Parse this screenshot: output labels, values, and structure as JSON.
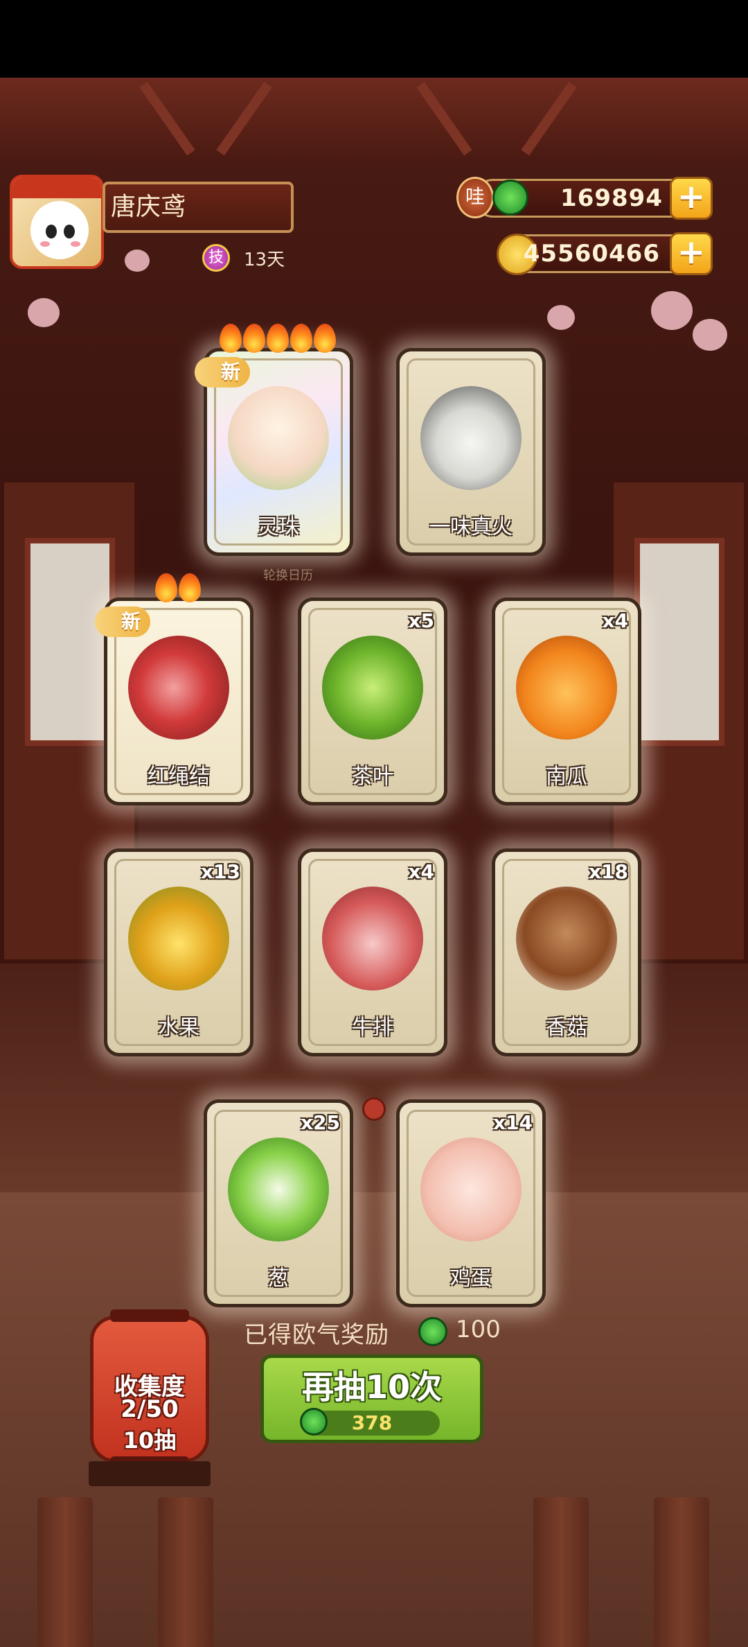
{
  "player": {
    "name": "唐庆鸢",
    "skill_icon": "技",
    "days": "13天"
  },
  "currencies": {
    "jade": {
      "icon": "jade-coin-icon",
      "badge": "哇",
      "value": "169894"
    },
    "gold": {
      "icon": "gold-coin-icon",
      "value": "45560466"
    },
    "plus_label": "+"
  },
  "scene_label": "轮换日历",
  "cards": [
    {
      "name": "灵珠",
      "count": "",
      "new": "新",
      "flames": 5,
      "style": "rainbow",
      "icon": "spirit-pearl-icon"
    },
    {
      "name": "一味真火",
      "count": "",
      "new": "",
      "flames": 0,
      "style": "plain",
      "icon": "true-fire-icon"
    },
    {
      "name": "红绳结",
      "count": "",
      "new": "新",
      "flames": 2,
      "style": "glowy",
      "icon": "red-knot-icon"
    },
    {
      "name": "茶叶",
      "count": "x5",
      "new": "",
      "flames": 0,
      "style": "plain",
      "icon": "tea-leaf-icon"
    },
    {
      "name": "南瓜",
      "count": "x4",
      "new": "",
      "flames": 0,
      "style": "plain",
      "icon": "pumpkin-icon"
    },
    {
      "name": "水果",
      "count": "x13",
      "new": "",
      "flames": 0,
      "style": "plain",
      "icon": "fruit-icon"
    },
    {
      "name": "牛排",
      "count": "x4",
      "new": "",
      "flames": 0,
      "style": "plain",
      "icon": "steak-icon"
    },
    {
      "name": "香菇",
      "count": "x18",
      "new": "",
      "flames": 0,
      "style": "plain",
      "icon": "mushroom-icon"
    },
    {
      "name": "葱",
      "count": "x25",
      "new": "",
      "flames": 0,
      "style": "plain",
      "icon": "scallion-icon"
    },
    {
      "name": "鸡蛋",
      "count": "x14",
      "new": "",
      "flames": 0,
      "style": "plain",
      "icon": "egg-icon"
    }
  ],
  "reward": {
    "label": "已得欧气奖励",
    "icon": "jade-coin-icon",
    "value": "100"
  },
  "draw_button": {
    "label": "再抽10次",
    "cost_icon": "jade-coin-icon",
    "cost": "378"
  },
  "collection": {
    "title": "收集度",
    "progress": "2/50",
    "draws": "10抽"
  },
  "colors": {
    "accent_green": "#8cc63f",
    "gold": "#f3a41a",
    "lantern_red": "#d2452c",
    "wood": "#4a1c14"
  }
}
